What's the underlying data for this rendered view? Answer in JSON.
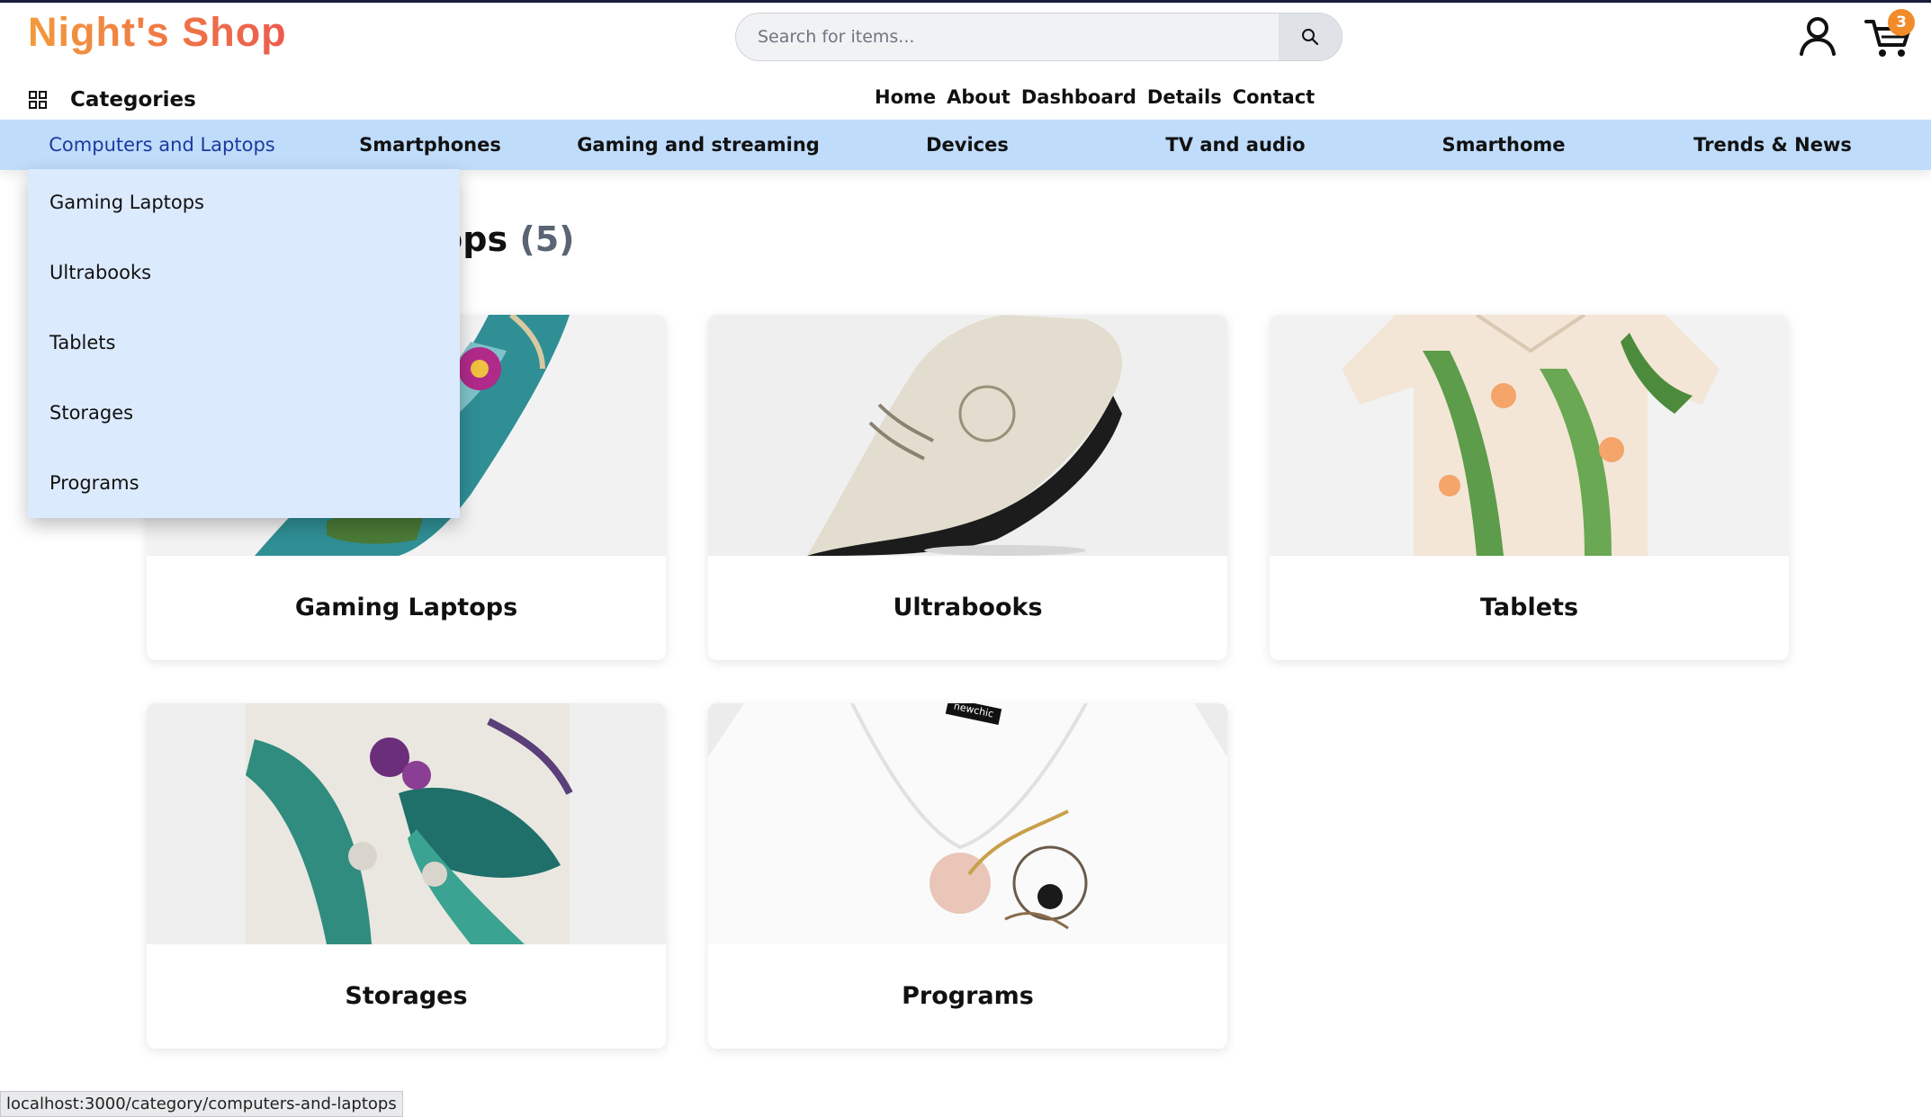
{
  "brand": {
    "logo": "Night's Shop"
  },
  "search": {
    "placeholder": "Search for items..."
  },
  "icons": {
    "search": "search-icon",
    "user": "user-icon",
    "cart": "cart-icon",
    "categories": "grid-icon"
  },
  "cart": {
    "count": "3"
  },
  "categories_toggle": {
    "label": "Categories"
  },
  "main_nav": [
    "Home",
    "About",
    "Dashboard",
    "Details",
    "Contact"
  ],
  "category_bar": {
    "active_index": 0,
    "items": [
      "Computers and Laptops",
      "Smartphones",
      "Gaming and streaming",
      "Devices",
      "TV and audio",
      "Smarthome",
      "Trends & News"
    ]
  },
  "dropdown": {
    "items": [
      "Gaming Laptops",
      "Ultrabooks",
      "Tablets",
      "Storages",
      "Programs"
    ]
  },
  "page": {
    "title_visible": "tops",
    "count": "(5)"
  },
  "products": [
    {
      "name": "Gaming Laptops",
      "image": "floral-shoe"
    },
    {
      "name": "Ultrabooks",
      "image": "beige-sneaker"
    },
    {
      "name": "Tablets",
      "image": "floral-shirt"
    },
    {
      "name": "Storages",
      "image": "tropical-pillow"
    },
    {
      "name": "Programs",
      "image": "embroidered-tshirt",
      "tag": "newchic"
    }
  ],
  "status_bar": {
    "url": "localhost:3000/category/computers-and-laptops"
  },
  "colors": {
    "accent": "#f28b2a",
    "category_bar": "#bfdcfb",
    "dropdown": "#dceafd",
    "active_link": "#1d3a9e"
  }
}
